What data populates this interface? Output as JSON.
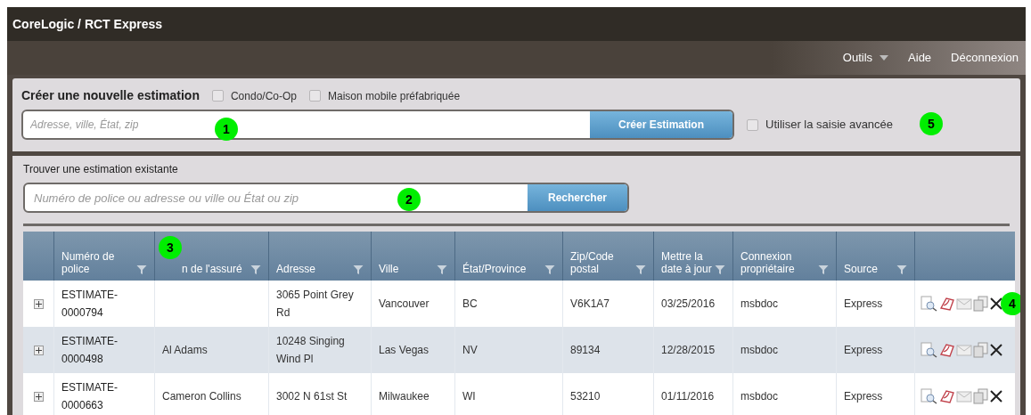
{
  "window": {
    "title": "CoreLogic / RCT Express"
  },
  "nav": [
    {
      "label": "Outils",
      "dropdown": true
    },
    {
      "label": "Aide",
      "dropdown": false
    },
    {
      "label": "Déconnexion",
      "dropdown": false
    }
  ],
  "new_estimate": {
    "title": "Créer une nouvelle estimation",
    "options": [
      {
        "label": "Condo/Co-Op",
        "checked": false
      },
      {
        "label": "Maison mobile préfabriquée",
        "checked": false
      }
    ],
    "address_field": {
      "placeholder": "Adresse, ville, État, zip"
    },
    "create_button": "Créer Estimation",
    "advanced": {
      "label": "Utiliser la saisie avancée",
      "checked": false
    }
  },
  "find_estimate": {
    "title": "Trouver une estimation existante",
    "search_field": {
      "placeholder": "Numéro de police ou adresse ou ville ou État ou zip"
    },
    "search_button": "Rechercher"
  },
  "table": {
    "columns": [
      "Numéro de police",
      "n de l'assuré",
      "Adresse",
      "Ville",
      "État/Province",
      "Zip/Code postal",
      "Mettre la date à jour",
      "Connexion propriétaire",
      "Source"
    ],
    "rows": [
      {
        "cells": [
          "ESTIMATE-0000794",
          "",
          "3065 Point Grey Rd",
          "Vancouver",
          "BC",
          "V6K1A7",
          "03/25/2016",
          "msbdoc",
          "Express"
        ]
      },
      {
        "cells": [
          "ESTIMATE-0000498",
          "Al Adams",
          "10248 Singing Wind Pl",
          "Las Vegas",
          "NV",
          "89134",
          "12/28/2015",
          "msbdoc",
          "Express"
        ]
      },
      {
        "cells": [
          "ESTIMATE-0000663",
          "Cameron Collins",
          "3002 N 61st St",
          "Milwaukee",
          "WI",
          "53210",
          "01/11/2016",
          "msbdoc",
          "Express"
        ]
      }
    ]
  },
  "callouts": [
    "1",
    "2",
    "3",
    "4",
    "5"
  ]
}
